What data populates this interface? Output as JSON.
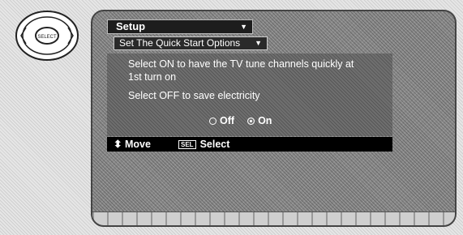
{
  "remote": {
    "center_button_label": "SELECT"
  },
  "menu": {
    "title": "Setup",
    "submenu": "Set The Quick Start Options"
  },
  "description": {
    "line1": "Select ON to have the TV tune channels quickly at",
    "line2": "1st turn on",
    "line3": "Select OFF to save electricity"
  },
  "options": {
    "off_label": "Off",
    "on_label": "On",
    "selected": "On"
  },
  "footer": {
    "move_label": "Move",
    "sel_key": "SEL",
    "select_label": "Select"
  },
  "colors": {
    "menu_bar": "#1d1d1d",
    "panel": "#6f6f6f",
    "footer": "#000000"
  }
}
